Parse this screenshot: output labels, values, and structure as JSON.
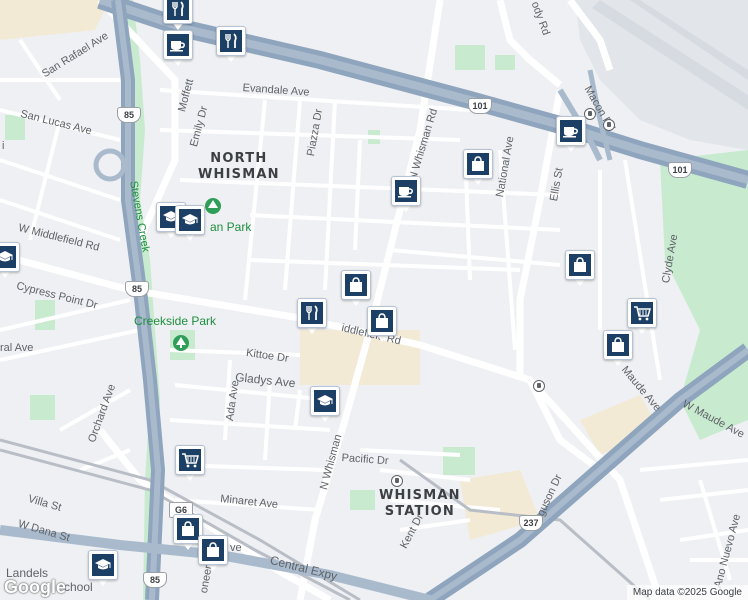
{
  "map": {
    "attribution": "Map data ©2025 Google",
    "logo": "Google",
    "colors": {
      "background": "#eef0f3",
      "local_road": "#ffffff",
      "highway": "#8fa4bd",
      "park": "#c8ebd0",
      "industrial": "#f3ead6",
      "airfield": "#e2e6ea",
      "rail": "#b9bec6",
      "pin": "#1c3f66"
    },
    "area_labels": [
      {
        "name": "north-whisman-label",
        "line1": "NORTH",
        "line2": "WHISMAN"
      },
      {
        "name": "whisman-station-label",
        "line1": "WHISMAN",
        "line2": "STATION"
      }
    ],
    "street_labels": {
      "evandale": "Evandale Ave",
      "moffett": "Moffett",
      "san_rafael": "San Rafael Ave",
      "san_lucas": "San Lucas Ave",
      "emily": "Emily Dr",
      "piazza": "Piazza Dr",
      "n_whisman_top": "N Whisman Rd",
      "w_middlefield": "W Middlefield Rd",
      "middlefield_mid": "iddlefield Rd",
      "cypress_point": "Cypress Point Dr",
      "kittoe": "Kittoe Dr",
      "gladys": "Gladys Ave",
      "ada": "Ada Ave",
      "orchard": "Orchard Ave",
      "n_whisman_bottom": "N Whisman",
      "pacific": "Pacific Dr",
      "minaret": "Minaret Ave",
      "villa": "Villa St",
      "w_dana": "W Dana St",
      "central_expy": "Central Expy",
      "kent": "Kent Dr",
      "ferguson": "Ferguson Dr",
      "ellis": "Ellis St",
      "national": "National Ave",
      "clyde": "Clyde Ave",
      "maude": "Maude Ave",
      "w_maude": "W Maude Ave",
      "ano_nuevo": "Ano Nuevo Ave",
      "macon": "Macon Rd",
      "body": "ody Rd",
      "stevens_creek": "Stevens Creek",
      "loneer": "oneer",
      "ave_fragment": "ve",
      "ral_ave": "ral Ave",
      "landels": "Landels",
      "school_fragment": "chool",
      "i_fragment": "i"
    },
    "park_labels": {
      "creekside": "Creekside Park",
      "an_park": "an Park"
    },
    "shields": {
      "hwy101_top": "101",
      "hwy101_right": "101",
      "hwy85_top": "85",
      "hwy85_mid": "85",
      "hwy85_bottom": "85",
      "g6": "G6",
      "hwy237": "237"
    },
    "pins": [
      {
        "name": "restaurant-pin-top",
        "icon": "restaurant"
      },
      {
        "name": "cafe-pin-moffett",
        "icon": "cafe"
      },
      {
        "name": "restaurant-pin-moffett",
        "icon": "restaurant"
      },
      {
        "name": "cafe-pin-101",
        "icon": "cafe"
      },
      {
        "name": "shopping-pin-national",
        "icon": "shopping"
      },
      {
        "name": "cafe-pin-whisman",
        "icon": "cafe"
      },
      {
        "name": "school-pin-park-1",
        "icon": "school"
      },
      {
        "name": "school-pin-park-2",
        "icon": "school"
      },
      {
        "name": "school-pin-left-edge",
        "icon": "school"
      },
      {
        "name": "shopping-pin-middlefield-1",
        "icon": "shopping"
      },
      {
        "name": "restaurant-pin-middlefield",
        "icon": "restaurant"
      },
      {
        "name": "shopping-pin-middlefield-2",
        "icon": "shopping"
      },
      {
        "name": "shopping-pin-ellis",
        "icon": "shopping"
      },
      {
        "name": "grocery-pin-clyde",
        "icon": "grocery"
      },
      {
        "name": "shopping-pin-maude",
        "icon": "shopping"
      },
      {
        "name": "school-pin-gladys",
        "icon": "school"
      },
      {
        "name": "grocery-pin-orchard",
        "icon": "grocery"
      },
      {
        "name": "shopping-pin-central-1",
        "icon": "shopping"
      },
      {
        "name": "shopping-pin-central-2",
        "icon": "shopping"
      },
      {
        "name": "school-pin-landels",
        "icon": "school"
      }
    ]
  }
}
